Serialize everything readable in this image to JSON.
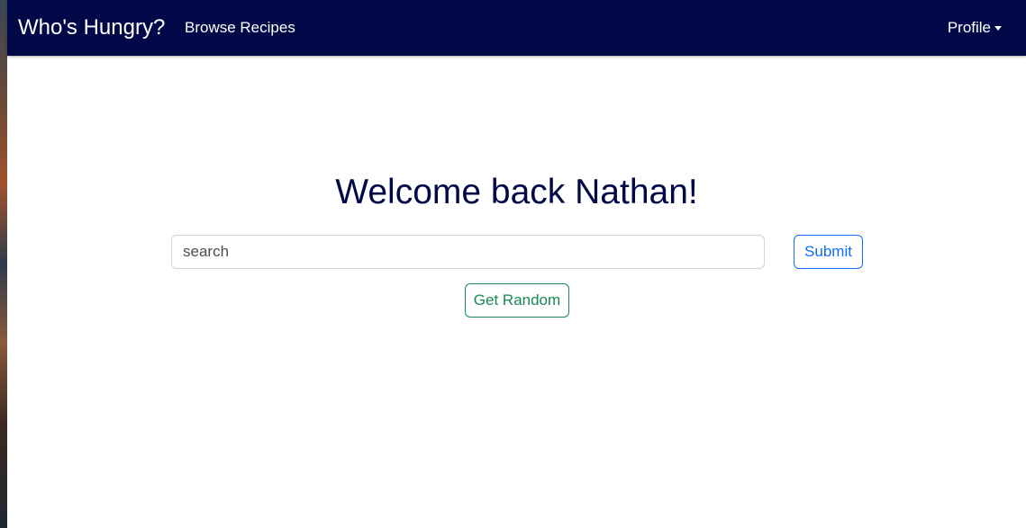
{
  "navbar": {
    "brand": "Who's Hungry?",
    "links": [
      "Browse Recipes"
    ],
    "profile_label": "Profile",
    "background_color": "#010848"
  },
  "main": {
    "title": "Welcome back Nathan!",
    "search": {
      "placeholder": "search",
      "value": ""
    },
    "submit_label": "Submit",
    "random_label": "Get Random"
  },
  "colors": {
    "title": "#010848",
    "submit": "#0d6efd",
    "random": "#198754"
  }
}
